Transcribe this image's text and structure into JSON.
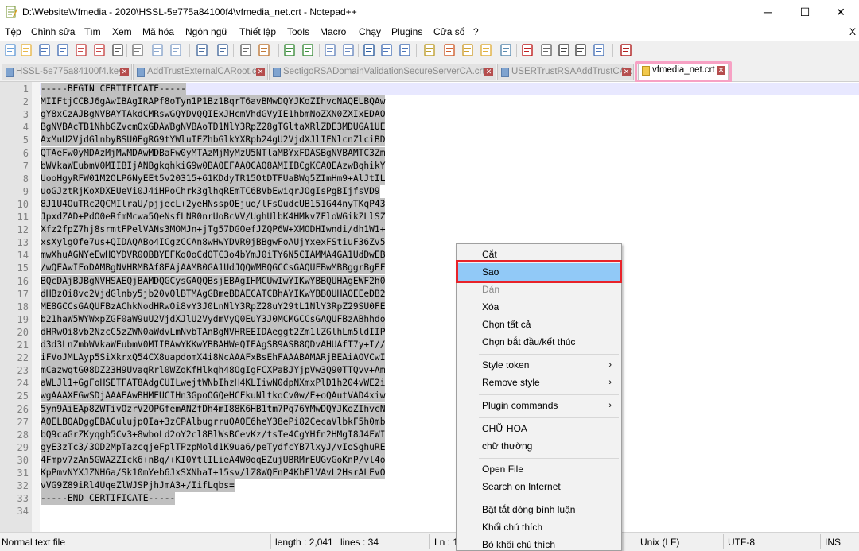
{
  "window": {
    "title": "D:\\Website\\Vfmedia - 2020\\HSSL-5e775a84100f4\\vfmedia_net.crt - Notepad++",
    "minimize_glyph": "─",
    "maximize_glyph": "☐",
    "close_glyph": "✕"
  },
  "menu": {
    "items": [
      "Tệp",
      "Chỉnh sửa",
      "Tìm",
      "Xem",
      "Mã hóa",
      "Ngôn ngữ",
      "Thiết lập",
      "Tools",
      "Macro",
      "Chạy",
      "Plugins",
      "Cửa sổ",
      "?"
    ],
    "close_x": "X"
  },
  "toolbar": {
    "icons": [
      "new-file-icon",
      "open-file-icon",
      "save-icon",
      "save-all-icon",
      "close-icon",
      "close-all-icon",
      "print-icon",
      "cut-icon",
      "copy-icon",
      "paste-icon",
      "undo-icon",
      "redo-icon",
      "find-icon",
      "replace-icon",
      "zoom-in-icon",
      "zoom-out-icon",
      "sync-vertical-icon",
      "sync-horizontal-icon",
      "word-wrap-icon",
      "show-all-chars-icon",
      "indent-guide-icon",
      "udl-icon",
      "doc-map-icon",
      "function-list-icon",
      "folder-workspace-icon",
      "monitor-icon",
      "record-macro-icon",
      "stop-record-icon",
      "playback-icon",
      "run-multiple-icon",
      "save-macro-icon",
      "spell-check-icon"
    ]
  },
  "tabs": [
    {
      "label": "HSSL-5e775a84100f4.key",
      "active": false
    },
    {
      "label": "AddTrustExternalCARoot.crt",
      "active": false
    },
    {
      "label": "SectigoRSADomainValidationSecureServerCA.crt",
      "active": false
    },
    {
      "label": "USERTrustRSAAddTrustCA.crt",
      "active": false
    },
    {
      "label": "vfmedia_net.crt",
      "active": true
    }
  ],
  "tab_close_glyph": "✕",
  "editor": {
    "lines": [
      "-----BEGIN CERTIFICATE-----",
      "MIIFtjCCBJ6gAwIBAgIRAPf8oTyn1P1Bz1BqrT6avBMwDQYJKoZIhvcNAQELBQAw",
      "gY8xCzAJBgNVBAYTAkdCMRswGQYDVQQIExJHcmVhdGVyIE1hbmNoZXN0ZXIxEDAO",
      "BgNVBAcTB1NhbGZvcmQxGDAWBgNVBAoTD1NlY3RpZ28gTGltaXRlZDE3MDUGA1UE",
      "AxMuU2VjdGlnbyBSU0EgRG9tYWluIFZhbGlkYXRpb24gU2VjdXJlIFNlcnZlciBD",
      "QTAeFw0yMDAzMjMwMDAwMDBaFw0yMTAzMjMyMzU5NTlaMBYxFDASBgNVBAMTC3Zm",
      "bWVkaWEubmV0MIIBIjANBgkqhkiG9w0BAQEFAAOCAQ8AMIIBCgKCAQEAzwBqhikY",
      "UooHgyRFW01M2OLP6NyEEt5v20315+61KDdyTR15OtDTFUaBWq5ZImHm9+AlJtIL",
      "uoGJztRjKoXDXEUeVi0J4iHPoChrk3glhqREmTC6BVbEwiqrJOgIsPgBIjfsVD9",
      "8J1U4OuTRc2QCMIlraU/pjjecL+2yeHNsspOEjuo/lFsOudcUB151G44nyTKqP43",
      "JpxdZAD+PdO0eRfmMcwa5QeNsfLNR0nrUoBcVV/UghUlbK4HMkv7FloWGikZLlSZ",
      "Xfz2fpZ7hj8srmtFPelVANs3MOMJn+jTg57DGOefJZQP6W+XMODHIwndi/dh1W1+",
      "xsXylgOfe7us+QIDAQABo4ICgzCCAn8wHwYDVR0jBBgwFoAUjYxexFStiuF36Zv5",
      "mwXhuAGNYeEwHQYDVR0OBBYEFKq0oCdOTC3o4bYmJ0iTY6N5CIAMMA4GA1UdDwEB",
      "/wQEAwIFoDAMBgNVHRMBAf8EAjAAMB0GA1UdJQQWMBQGCCsGAQUFBwMBBggrBgEF",
      "BQcDAjBJBgNVHSAEQjBAMDQGCysGAQQBsjEBAgIHMCUwIwYIKwYBBQUHAgEWF2h0",
      "dHBzOi8vc2VjdGlnby5jb20vQlBTMAgGBmeBDAECATCBhAYIKwYBBQUHAQEEeDB2",
      "ME8GCCsGAQUFBzAChkNodHRwOi8vY3J0LnNlY3RpZ28uY29tL1NlY3RpZ29SU0FE",
      "b21haW5WYWxpZGF0aW9uU2VjdXJlU2VydmVyQ0EuY3J0MCMGCCsGAQUFBzABhhdo",
      "dHRwOi8vb2NzcC5zZWN0aWdvLmNvbTAnBgNVHREEIDAeggt2Zm1lZGlhLm5ldIIP",
      "d3d3LnZmbWVkaWEubmV0MIIBAwYKKwYBBAHWeQIEAgSB9ASB8QDvAHUAfT7y+I//",
      "iFVoJMLAyp5SiXkrxQ54CX8uapdomX4i8NcAAAFxBsEhFAAABAMARjBEAiAOVCwI",
      "mCazwqtG08DZ23H9UvaqRrl0WZqKfHlkqh48OgIgFCXPaBJYjpVw3Q90TTQvv+Am",
      "aWLJl1+GgFoHSETFAT8AdgCUILwejtWNbIhzH4KLIiwN0dpNXmxPlD1h204vWE2i",
      "wgAAAXEGwSDjAAAEAwBHMEUCIHn3GpoOGQeHCFkuNltkoCv0w/E+oQAutVAD4xiw",
      "5yn9AiEAp8ZWTivOzrV2OPGfemANZfDh4mI88K6HB1tm7Pq76YMwDQYJKoZIhvcN",
      "AQELBQADggEBACulujpQIa+3zCPAlbugrruOAOE6heY38ePi82CecaVlbkF5h0mb",
      "bQ9caGrZKyqgh5Cv3+8wboLd2oY2cl8BlWsBCevKz/tsTe4CgYHfn2HMgI8J4FWI",
      "gyE3zTc3/3OD2MpTazcqjeFplTPzpMold1K9ua6/peTydfcYB7lxyJ/vIoSghuRE",
      "4Fmpv7zAn5GWAZZIck6+nBq/+KI0YtlILieA4W0qqEZujUBRMrEUGvGoKnP/vl4o",
      "KpPmvNYXJZNH6a/Sk10mYeb6JxSXNhaI+15sv/lZ8WQFnP4KbFlVAvL2HsrALEvO",
      "vVG9Z89iRl4UqeZlWJSPjhJmA3+/IifLqbs=",
      "-----END CERTIFICATE-----",
      ""
    ]
  },
  "status": {
    "filetype": "Normal text file",
    "length": "length : 2,041",
    "lines": "lines : 34",
    "ln": "Ln : 1",
    "eol": "Unix (LF)",
    "encoding": "UTF-8",
    "mode": "INS"
  },
  "context_menu": {
    "items": [
      {
        "label": "Cắt",
        "state": "normal"
      },
      {
        "label": "Sao",
        "state": "hover"
      },
      {
        "label": "Dán",
        "state": "disabled"
      },
      {
        "label": "Xóa",
        "state": "normal"
      },
      {
        "label": "Chọn tất cả",
        "state": "normal"
      },
      {
        "label": "Chọn bắt đầu/kết thúc",
        "state": "normal"
      },
      {
        "label": "Style token",
        "state": "submenu"
      },
      {
        "label": "Remove style",
        "state": "submenu"
      },
      {
        "label": "Plugin commands",
        "state": "submenu"
      },
      {
        "label": "CHỮ HOA",
        "state": "normal"
      },
      {
        "label": "chữ thường",
        "state": "normal"
      },
      {
        "label": "Open File",
        "state": "normal"
      },
      {
        "label": "Search on Internet",
        "state": "normal"
      },
      {
        "label": "Bật tắt dòng bình luận",
        "state": "normal"
      },
      {
        "label": "Khối chú thích",
        "state": "normal"
      },
      {
        "label": "Bỏ khối chú thích",
        "state": "normal"
      }
    ],
    "submenu_arrow": "›"
  },
  "colors": {
    "selection": "#c0c0c0",
    "current_line": "#e8e8ff",
    "menu_hover": "#91c9f7",
    "highlight_red": "#e8232a",
    "highlight_pink": "#f7a1c4"
  }
}
